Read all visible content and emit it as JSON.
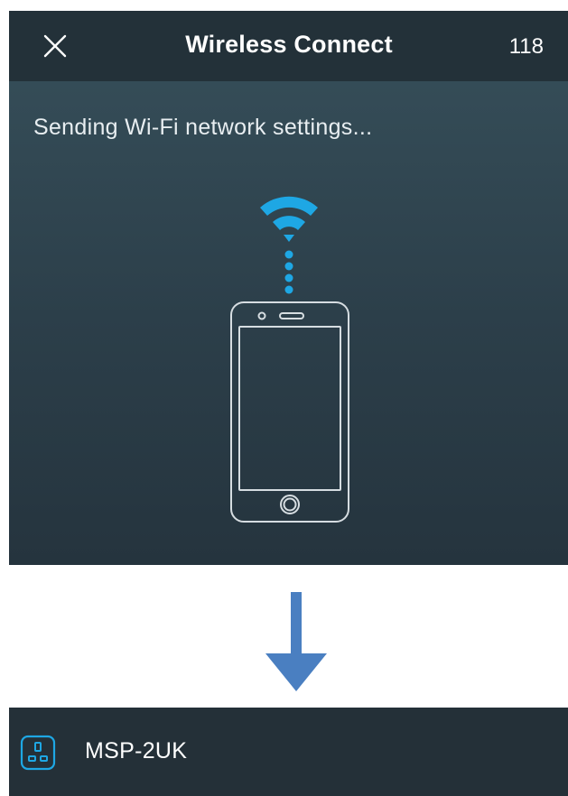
{
  "header": {
    "title": "Wireless Connect",
    "count": "118",
    "close_icon": "close-icon"
  },
  "status": {
    "message": "Sending Wi-Fi network settings..."
  },
  "illustration": {
    "wifi_icon": "wifi-icon",
    "phone_icon": "smartphone-icon"
  },
  "arrow_icon": "arrow-down-icon",
  "device": {
    "name": "MSP-2UK",
    "icon": "smart-plug-icon"
  },
  "colors": {
    "accent_blue": "#1ea7e4",
    "arrow_blue": "#4a7fc1",
    "navbar": "#233139",
    "screen_bg": "#2f4450",
    "device_bar": "#243038"
  }
}
